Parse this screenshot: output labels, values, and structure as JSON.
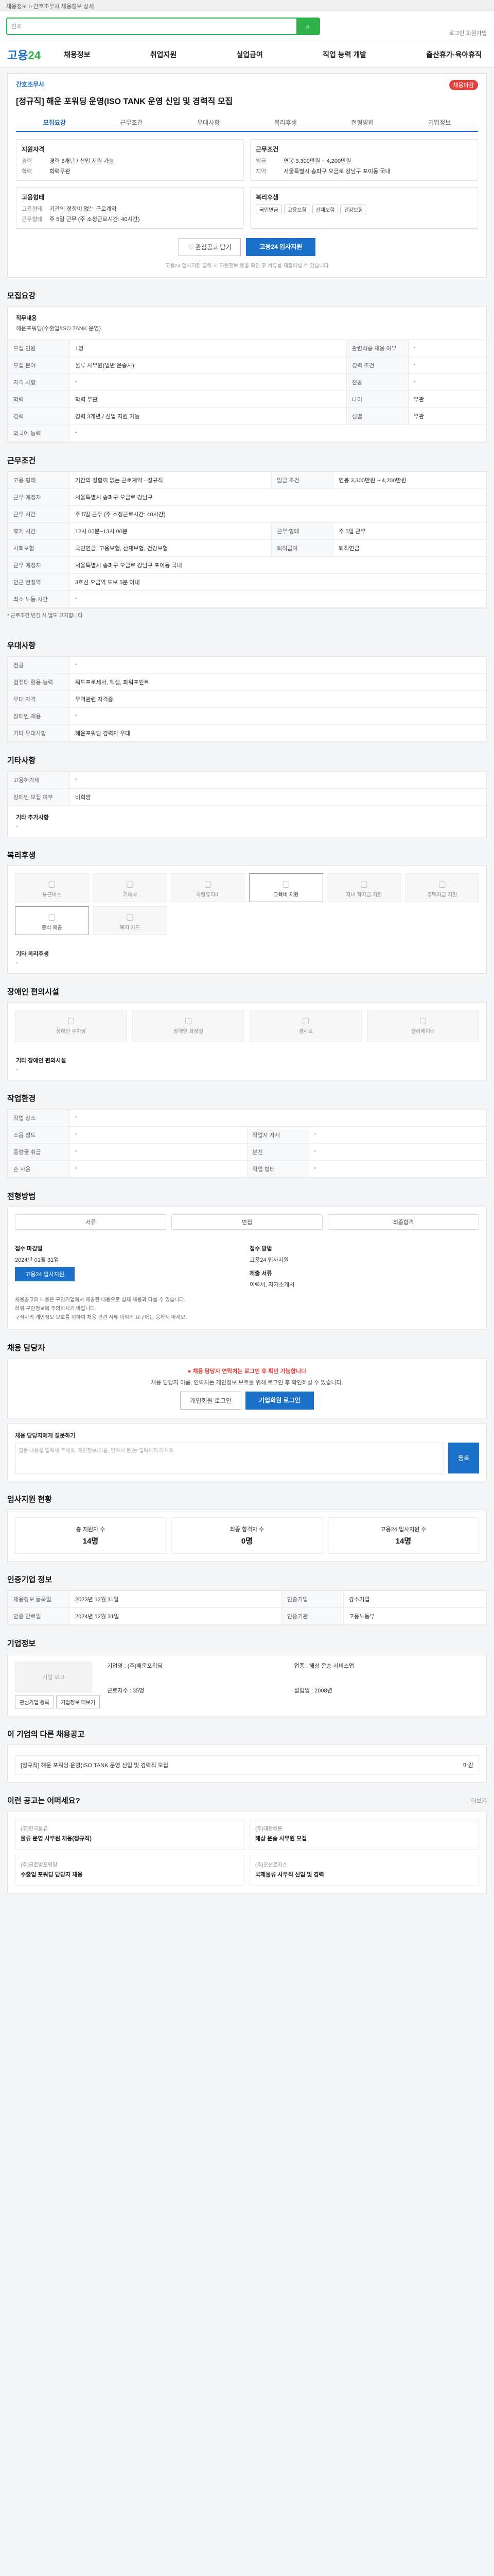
{
  "topbar": {
    "text": "채용정보 > 간호조무사 채용정보 상세"
  },
  "search": {
    "tag": "전체",
    "button": "검색"
  },
  "util": {
    "text": "로그인  회원가입"
  },
  "logo": {
    "brand": "고용",
    "num": "24"
  },
  "gnb": [
    "채용정보",
    "취업지원",
    "실업급여",
    "직업 능력 개발",
    "출산휴가·육아휴직"
  ],
  "head": {
    "category": "간호조무사",
    "badge": "채용마감",
    "title": "[정규직] 해운 포워딩 운영(ISO TANK 운영 신입 및 경력직 모집",
    "tabs": [
      "모집요강",
      "근무조건",
      "우대사항",
      "복리후생",
      "전형방법",
      "기업정보"
    ],
    "left": {
      "title": "지원자격",
      "rows": [
        {
          "k": "경력",
          "v": "경력 3개년 / 신입 지원 가능"
        },
        {
          "k": "학력",
          "v": "학력무관"
        }
      ]
    },
    "right": {
      "title": "근무조건",
      "rows": [
        {
          "k": "임금",
          "v": "연봉 3,300만원 ~ 4,200만원"
        },
        {
          "k": "지역",
          "v": "서울특별시 송파구 오금로 강남구 포이동 국내"
        }
      ]
    },
    "left2": {
      "title": "고용형태",
      "rows": [
        {
          "k": "고용형태",
          "v": "기간의 정함이 없는 근로계약"
        },
        {
          "k": "근무형태",
          "v": "주 5일 근무 (주 소정근로시간: 40시간)"
        }
      ]
    },
    "right2": {
      "title": "복리후생",
      "chips": [
        "국민연금",
        "고용보험",
        "산재보험",
        "건강보험"
      ]
    },
    "btn_scrap": "관심공고 담기",
    "btn_apply": "고용24 입사지원",
    "note": "고용24 입사지원 클릭 시 지원정보 등을 확인 후 서류를 제출하실 수 있습니다"
  },
  "recruit": {
    "title": "모집요강",
    "duty_label": "직무내용",
    "duty": "해운포워딩(수출입/ISO TANK 운영)",
    "rows": [
      {
        "k": "모집 인원",
        "v": "1명",
        "k2": "관련직종 채용 여부",
        "v2": "-"
      },
      {
        "k": "모집 분야",
        "v": "물류 사무원(일반 운송사)",
        "k2": "경력 조건",
        "v2": "-"
      },
      {
        "k": "자격 사항",
        "v": "-",
        "k2": "전공",
        "v2": "-"
      },
      {
        "k": "학력",
        "v": "학력 무관",
        "k2": "나이",
        "v2": "무관"
      },
      {
        "k": "경력",
        "v": "경력 3개년 / 신입 지원 가능",
        "k2": "성별",
        "v2": "무관"
      },
      {
        "k": "외국어 능력",
        "v": "-",
        "k2": "",
        "v2": ""
      }
    ]
  },
  "work": {
    "title": "근무조건",
    "rows": [
      {
        "k": "고용 형태",
        "v": "기간의 정함이 없는 근로계약 - 정규직",
        "k2": "임금 조건",
        "v2": "연봉 3,300만원 ~ 4,200만원"
      },
      {
        "k": "근무 예정지",
        "v": "서울특별시 송파구 오금로 강남구",
        "k2": "",
        "v2": ""
      },
      {
        "k": "근무 시간",
        "v": "주 5일 근무 (주 소정근로시간: 40시간)",
        "k2": "",
        "v2": ""
      },
      {
        "k": "휴게 시간",
        "v": "12시 00분~13시 00분",
        "k2": "근무 형태",
        "v2": "주 5일 근무"
      },
      {
        "k": "사회보험",
        "v": "국민연금, 고용보험, 산재보험, 건강보험",
        "k2": "퇴직급여",
        "v2": "퇴직연금"
      },
      {
        "k": "근무 예정지",
        "v": "서울특별시 송파구 오금로 강남구 포이동 국내",
        "k2": "",
        "v2": ""
      },
      {
        "k": "인근 전철역",
        "v": "3호선 오금역 도보 5분 이내",
        "k2": "",
        "v2": ""
      },
      {
        "k": "최소 노동 시간",
        "v": "-",
        "k2": "",
        "v2": ""
      }
    ],
    "note": "* 근로조건 변경 시 별도 고지합니다"
  },
  "prefer": {
    "title": "우대사항",
    "rows": [
      {
        "k": "전공",
        "v": "-"
      },
      {
        "k": "컴퓨터 활용 능력",
        "v": "워드프로세서, 엑셀, 파워포인트"
      },
      {
        "k": "우대 자격",
        "v": "무역관련 자격증"
      },
      {
        "k": "장애인 채용",
        "v": "-"
      },
      {
        "k": "기타 우대사항",
        "v": "해운포워딩 경력자 우대"
      }
    ]
  },
  "etc": {
    "title": "기타사항",
    "rows": [
      {
        "k": "고용허가제",
        "v": "-"
      },
      {
        "k": "장애인 모집 여부",
        "v": "비희망"
      }
    ],
    "extra_label": "기타 추가사항",
    "extra": "-"
  },
  "welfare": {
    "title": "복리후생",
    "items": [
      "통근버스",
      "기숙사",
      "차량유지비",
      "교육비 지원",
      "자녀 학자금 지원",
      "주택자금 지원",
      "중식 제공",
      "복지 카드"
    ],
    "on": [
      3,
      6
    ],
    "extra_label": "기타 복리후생",
    "extra": "-"
  },
  "disabled": {
    "title": "장애인 편의시설",
    "items": [
      "장애인 주차장",
      "장애인 화장실",
      "경사로",
      "엘리베이터"
    ],
    "extra_label": "기타 장애인 편의시설",
    "extra": "-"
  },
  "env": {
    "title": "작업환경",
    "rows": [
      {
        "k": "작업 장소",
        "v": "-",
        "k2": "",
        "v2": ""
      },
      {
        "k": "소음 정도",
        "v": "-",
        "k2": "작업자 자세",
        "v2": "-"
      },
      {
        "k": "중량물 취급",
        "v": "-",
        "k2": "분진",
        "v2": "-"
      },
      {
        "k": "손 사용",
        "v": "-",
        "k2": "작업 형태",
        "v2": "-"
      }
    ]
  },
  "process": {
    "title": "전형방법",
    "steps": [
      "서류",
      "면접",
      "최종합격"
    ],
    "apply_title": "접수 마감일",
    "apply_date": "2024년 01월 31일",
    "apply_btn": "고용24 입사지원",
    "method_title": "접수 방법",
    "method": "고용24 입사지원",
    "doc_title": "제출 서류",
    "doc": "이력서, 자기소개서",
    "bullets": [
      "채용공고의 내용은 구인기업에서 제공한 내용으로 실제 채용과 다를 수 있습니다.",
      "허위 구인정보에 주의하시기 바랍니다.",
      "구직자의 개인정보 보호를 위하여 채용 관련 서류 이외의 요구에는 응하지 마세요."
    ]
  },
  "contact": {
    "title": "채용 담당자",
    "alert": "채용 담당자 연락처는 로그인 후 확인 가능합니다",
    "desc": "채용 담당자 이름, 연락처는 개인정보 보호를 위해 로그인 후 확인하실 수 있습니다.",
    "btn1": "개인회원 로그인",
    "btn2": "기업회원 로그인"
  },
  "qa": {
    "label": "채용 담당자에게 질문하기",
    "placeholder": "질문 내용을 입력해 주세요. 개인정보(이름, 연락처 등)는 입력하지 마세요.",
    "btn": "등록"
  },
  "stats": {
    "title": "입사지원 현황",
    "items": [
      {
        "k": "총 지원자 수",
        "v": "14명"
      },
      {
        "k": "최종 합격자 수",
        "v": "0명"
      },
      {
        "k": "고용24 입사지원 수",
        "v": "14명"
      }
    ]
  },
  "info": {
    "title": "인증기업 정보",
    "rows": [
      {
        "k": "채용정보 등록일",
        "v": "2023년 12월 11일",
        "k2": "인증기업",
        "v2": "강소기업"
      },
      {
        "k": "인증 만료일",
        "v": "2024년 12월 31일",
        "k2": "인증기관",
        "v2": "고용노동부"
      }
    ]
  },
  "company": {
    "title": "기업정보",
    "logo": "기업 로고",
    "btn1": "관심기업 등록",
    "btn2": "기업정보 더보기",
    "rows": [
      {
        "k": "기업명",
        "v": "(주)해운포워딩"
      },
      {
        "k": "업종",
        "v": "해상 운송 서비스업"
      },
      {
        "k": "근로자수",
        "v": "35명"
      },
      {
        "k": "설립일",
        "v": "2008년"
      }
    ]
  },
  "related": {
    "title": "이 기업의 다른 채용공고",
    "items": [
      {
        "t": "[정규직] 해운 포워딩 운영(ISO TANK 운영 신입 및 경력직 모집",
        "d": "마감"
      }
    ]
  },
  "recommend": {
    "title": "이런 공고는 어떠세요?",
    "more": "더보기",
    "items": [
      {
        "co": "(주)한국물류",
        "t": "물류 운영 사무원 채용(정규직)"
      },
      {
        "co": "(주)대한해운",
        "t": "해상 운송 사무원 모집"
      },
      {
        "co": "(주)글로벌포워딩",
        "t": "수출입 포워딩 담당자 채용"
      },
      {
        "co": "(주)오션로지스",
        "t": "국제물류 사무직 신입 및 경력"
      }
    ]
  }
}
